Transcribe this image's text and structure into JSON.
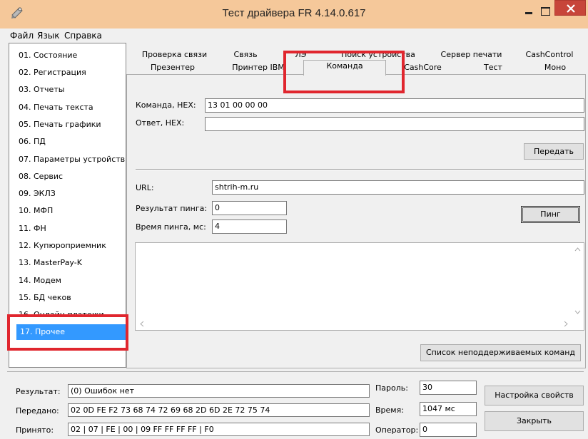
{
  "window": {
    "title": "Тест драйвера FR 4.14.0.617"
  },
  "menu": [
    "Файл",
    "Язык",
    "Справка"
  ],
  "nav": {
    "items": [
      "01. Состояние",
      "02. Регистрация",
      "03. Отчеты",
      "04. Печать текста",
      "05. Печать графики",
      "06. ПД",
      "07. Параметры устройств",
      "08. Сервис",
      "09. ЭКЛЗ",
      "10. МФП",
      "11. ФН",
      "12. Купюроприемник",
      "13. MasterPay-K",
      "14. Модем",
      "15. БД чеков",
      "16. Онлайн платежи",
      "17. Прочее"
    ],
    "selected_index": 16
  },
  "tabs": {
    "row1": [
      "Проверка связи",
      "Связь",
      "ЛЭ",
      "Поиск устройства",
      "Сервер печати",
      "CashControl"
    ],
    "row2": [
      "Презентер",
      "Принтер IBM",
      "Команда",
      "CashCore",
      "Тест",
      "Моно"
    ],
    "active": "Команда"
  },
  "command": {
    "cmd_label": "Команда, HEX:",
    "cmd_value": "13 01 00 00 00",
    "answer_label": "Ответ, HEX:",
    "answer_value": "",
    "send_button": "Передать"
  },
  "ping": {
    "url_label": "URL:",
    "url_value": "shtrih-m.ru",
    "result_label": "Результат пинга:",
    "result_value": "0",
    "time_label": "Время пинга, мс:",
    "time_value": "4",
    "ping_button": "Пинг"
  },
  "memo": {
    "text": ""
  },
  "unsupported_button": "Список неподдерживаемых команд",
  "status": {
    "result_label": "Результат:",
    "result_value": "(0) Ошибок нет",
    "sent_label": "Передано:",
    "sent_value": "02 0D FE F2 73 68 74 72 69 68 2D 6D 2E 72 75 74",
    "received_label": "Принято:",
    "received_value": "02 | 07 | FE | 00 | 09 FF FF FF FF | F0",
    "password_label": "Пароль:",
    "password_value": "30",
    "time_label": "Время:",
    "time_value": "1047 мс",
    "operator_label": "Оператор:",
    "operator_value": "0",
    "settings_button": "Настройка свойств",
    "close_button": "Закрыть"
  },
  "colors": {
    "titlebar": "#f5c89a",
    "selection": "#3399ff",
    "highlight_frame": "#e0262e",
    "close_button": "#c7453a"
  }
}
